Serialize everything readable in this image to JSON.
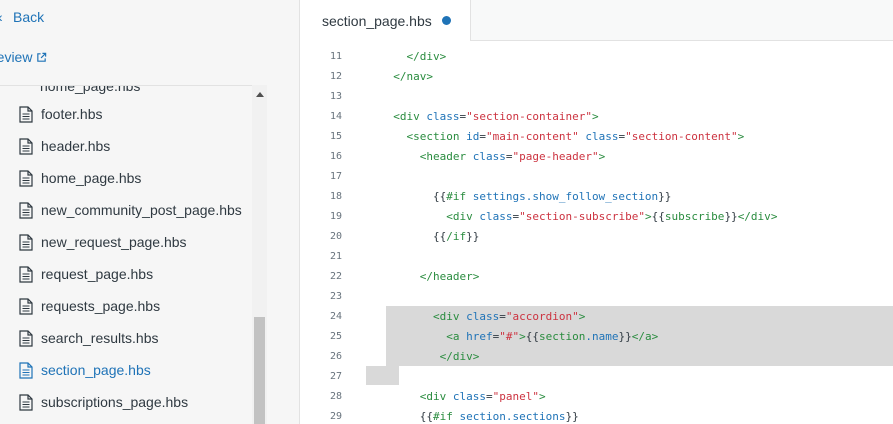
{
  "sidebar": {
    "back_label": "Back",
    "preview_label": "review",
    "partial_item": "home_page.hbs",
    "files": [
      {
        "label": "footer.hbs",
        "active": false
      },
      {
        "label": "header.hbs",
        "active": false
      },
      {
        "label": "home_page.hbs",
        "active": false
      },
      {
        "label": "new_community_post_page.hbs",
        "active": false
      },
      {
        "label": "new_request_page.hbs",
        "active": false
      },
      {
        "label": "request_page.hbs",
        "active": false
      },
      {
        "label": "requests_page.hbs",
        "active": false
      },
      {
        "label": "search_results.hbs",
        "active": false
      },
      {
        "label": "section_page.hbs",
        "active": true
      },
      {
        "label": "subscriptions_page.hbs",
        "active": false
      }
    ]
  },
  "editor": {
    "tab_label": "section_page.hbs",
    "tab_modified": true,
    "lines": [
      {
        "n": "11",
        "text": "    </div>"
      },
      {
        "n": "12",
        "text": "  </nav>"
      },
      {
        "n": "13",
        "text": ""
      },
      {
        "n": "14",
        "text": "  <div class=\"section-container\">"
      },
      {
        "n": "15",
        "text": "    <section id=\"main-content\" class=\"section-content\">"
      },
      {
        "n": "16",
        "text": "      <header class=\"page-header\">"
      },
      {
        "n": "17",
        "text": ""
      },
      {
        "n": "18",
        "text": "        {{#if settings.show_follow_section}}"
      },
      {
        "n": "19",
        "text": "          <div class=\"section-subscribe\">{{subscribe}}</div>"
      },
      {
        "n": "20",
        "text": "        {{/if}}"
      },
      {
        "n": "21",
        "text": ""
      },
      {
        "n": "22",
        "text": "      </header>"
      },
      {
        "n": "23",
        "text": ""
      },
      {
        "n": "24",
        "text": "        <div class=\"accordion\">"
      },
      {
        "n": "25",
        "text": "          <a href=\"#\">{{section.name}}</a>"
      },
      {
        "n": "26",
        "text": "         </div>"
      },
      {
        "n": "27",
        "text": ""
      },
      {
        "n": "28",
        "text": "      <div class=\"panel\">"
      },
      {
        "n": "29",
        "text": "      {{#if section.sections}}"
      }
    ]
  },
  "colors": {
    "accent": "#1f73b7",
    "tag": "#2a8c3f",
    "attr": "#1f73b7",
    "string": "#cc3340",
    "selection": "#d9d9d9"
  }
}
